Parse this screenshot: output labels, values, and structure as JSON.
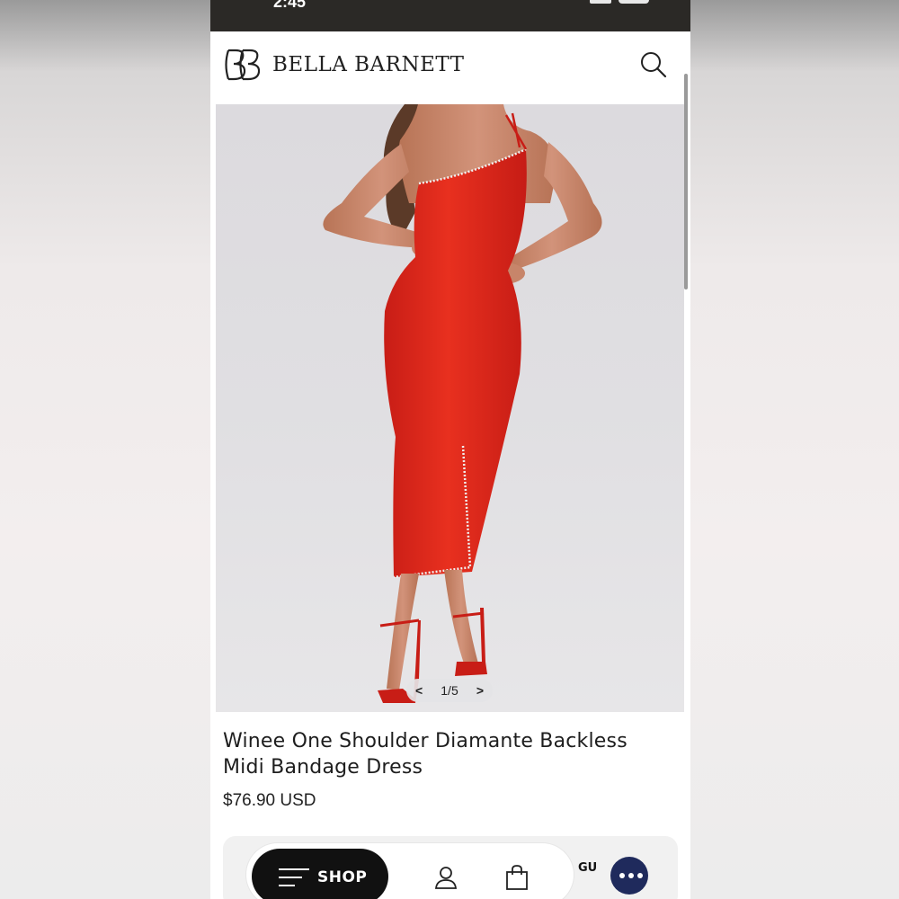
{
  "status_bar": {
    "time": "2:45"
  },
  "header": {
    "brand": "BELLA BARNETT",
    "logo_icon": "bb-monogram-icon",
    "search_icon": "search-icon"
  },
  "gallery": {
    "pager": "1/5",
    "prev": "<",
    "next": ">"
  },
  "product": {
    "title": "Winee One Shoulder Diamante Backless Midi Bandage Dress",
    "price": "$76.90 USD",
    "dress_color": "#e0281e"
  },
  "bottom_nav": {
    "shop_label": "SHOP",
    "guide_label": "GU",
    "menu_icon": "menu-icon",
    "account_icon": "user-icon",
    "bag_icon": "shopping-bag-icon",
    "chat_icon": "chat-icon",
    "chat_color": "#1f2a5c"
  }
}
